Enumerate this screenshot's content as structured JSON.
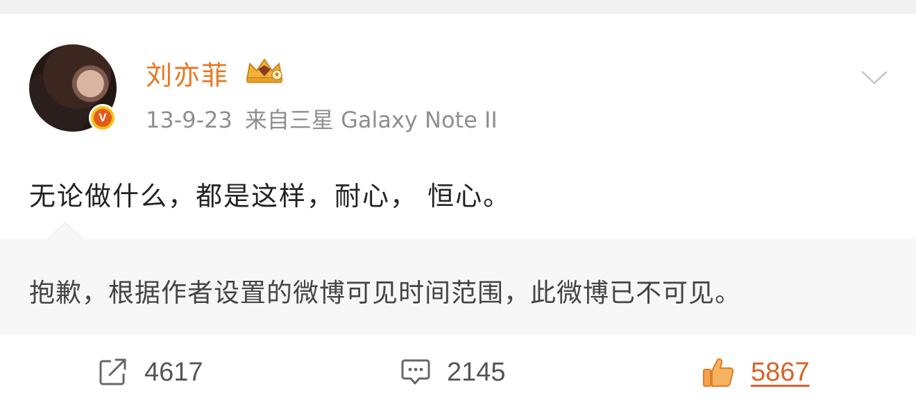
{
  "user": {
    "name": "刘亦菲",
    "date": "13-9-23",
    "source": "来自三星 Galaxy Note II",
    "verified_mark": "V"
  },
  "post": {
    "text": "无论做什么，都是这样，耐心， 恒心。"
  },
  "notice": {
    "text": "抱歉，根据作者设置的微博可见时间范围，此微博已不可见。"
  },
  "actions": {
    "repost_count": "4617",
    "comment_count": "2145",
    "like_count": "5867",
    "icons": {
      "repost": "share-arrow-icon",
      "comment": "comment-bubble-icon",
      "like": "thumbs-up-icon"
    }
  },
  "colors": {
    "username": "#e8761f",
    "like_accent": "#d9622b",
    "badge_gold": "#f6c21a"
  }
}
